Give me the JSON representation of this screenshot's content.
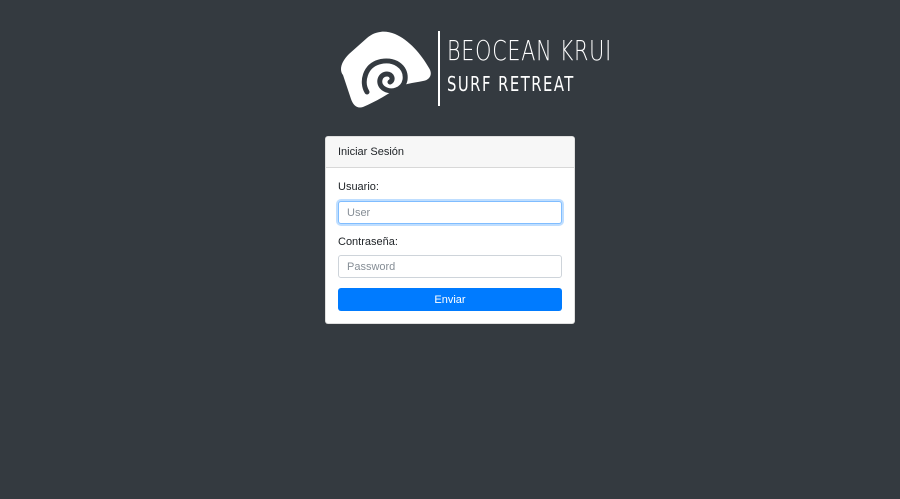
{
  "brand": {
    "title": "BEOCEAN KRUI",
    "subtitle": "SURF RETREAT",
    "logo_icon": "wave-logo-icon"
  },
  "login": {
    "header": "Iniciar Sesión",
    "username": {
      "label": "Usuario:",
      "placeholder": "User",
      "value": ""
    },
    "password": {
      "label": "Contraseña:",
      "placeholder": "Password",
      "value": ""
    },
    "submit_label": "Enviar"
  },
  "colors": {
    "background": "#343a40",
    "primary": "#007bff",
    "card": "#ffffff",
    "card_header": "#f7f7f7"
  }
}
